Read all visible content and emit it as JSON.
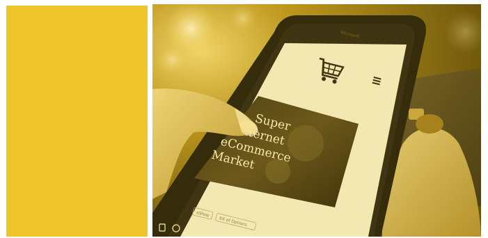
{
  "swatch": {
    "color": "#eec52a"
  },
  "photo": {
    "tint": "#e2b81f",
    "phone_brand": "Microsoft",
    "cart_icon": "shopping-cart-icon",
    "menu_icon": "hamburger-menu-icon",
    "hero_lines": [
      "Super",
      "Internet",
      "eCommerce",
      "Market"
    ],
    "chips": [
      "eShop",
      "Kit of Options"
    ]
  }
}
